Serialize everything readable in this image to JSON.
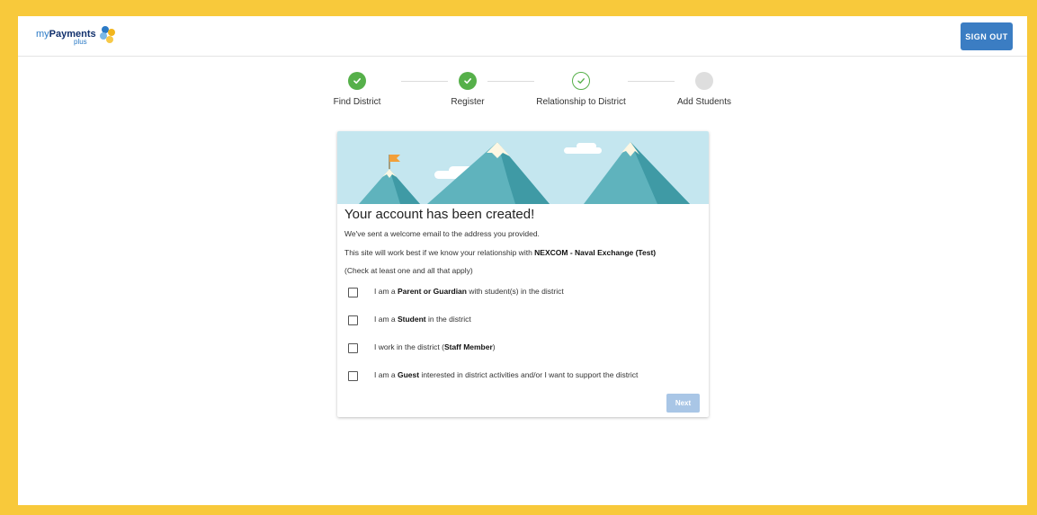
{
  "header": {
    "logo_my": "my",
    "logo_payments": "Payments",
    "logo_plus": "plus",
    "signout_label": "SIGN OUT"
  },
  "stepper": {
    "steps": [
      {
        "label": "Find District",
        "state": "done"
      },
      {
        "label": "Register",
        "state": "done"
      },
      {
        "label": "Relationship to District",
        "state": "current"
      },
      {
        "label": "Add Students",
        "state": "todo"
      }
    ]
  },
  "card": {
    "title": "Your account has been created!",
    "line1": "We've sent a welcome email to the address you provided.",
    "line2_prefix": "This site will work best if we know your relationship with ",
    "line2_district": "NEXCOM - Naval Exchange (Test)",
    "line3": "(Check at least one and all that apply)",
    "options": [
      {
        "pre": "I am a ",
        "bold": "Parent or Guardian",
        "post": " with student(s) in the district",
        "checked": false
      },
      {
        "pre": "I am a ",
        "bold": "Student",
        "post": " in the district",
        "checked": false
      },
      {
        "pre": "I work in the district (",
        "bold": "Staff Member",
        "post": ")",
        "checked": false
      },
      {
        "pre": "I am a ",
        "bold": "Guest",
        "post": " interested in district activities and/or I want to support the district",
        "checked": false
      }
    ],
    "next_label": "Next"
  },
  "colors": {
    "frame_border": "#f8c93b",
    "primary_button": "#3b7dc3",
    "step_done": "#56b04a",
    "step_todo": "#dedede",
    "next_disabled": "#a9c6e6",
    "banner_sky": "#c4e6ef",
    "mountain": "#5fb3bd"
  },
  "icons": {
    "logo_mark": "logo-dots-icon",
    "step_done": "check-icon",
    "flag": "flag-icon"
  }
}
